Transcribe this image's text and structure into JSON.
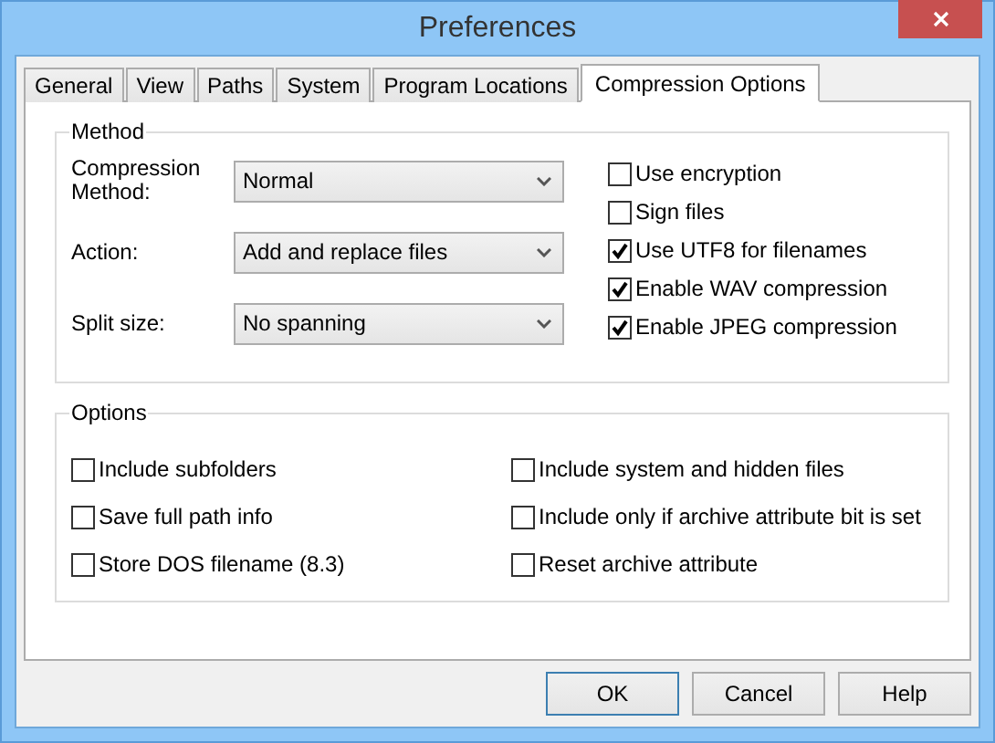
{
  "window": {
    "title": "Preferences"
  },
  "tabs": [
    {
      "label": "General",
      "selected": false
    },
    {
      "label": "View",
      "selected": false
    },
    {
      "label": "Paths",
      "selected": false
    },
    {
      "label": "System",
      "selected": false
    },
    {
      "label": "Program Locations",
      "selected": false
    },
    {
      "label": "Compression Options",
      "selected": true
    }
  ],
  "method": {
    "title": "Method",
    "fields": [
      {
        "label": "Compression Method:",
        "value": "Normal"
      },
      {
        "label": "Action:",
        "value": "Add and replace files"
      },
      {
        "label": "Split size:",
        "value": "No spanning"
      }
    ],
    "checkboxes": [
      {
        "label": "Use encryption",
        "checked": false
      },
      {
        "label": "Sign files",
        "checked": false
      },
      {
        "label": "Use UTF8 for filenames",
        "checked": true
      },
      {
        "label": "Enable WAV compression",
        "checked": true
      },
      {
        "label": "Enable JPEG compression",
        "checked": true
      }
    ]
  },
  "options": {
    "title": "Options",
    "checkboxes": [
      {
        "label": "Include subfolders",
        "checked": false
      },
      {
        "label": "Include system and hidden files",
        "checked": false
      },
      {
        "label": "Save full path info",
        "checked": false
      },
      {
        "label": "Include only if archive attribute bit is set",
        "checked": false
      },
      {
        "label": "Store DOS filename (8.3)",
        "checked": false
      },
      {
        "label": "Reset archive attribute",
        "checked": false
      }
    ]
  },
  "buttons": [
    {
      "label": "OK",
      "default": true
    },
    {
      "label": "Cancel",
      "default": false
    },
    {
      "label": "Help",
      "default": false
    }
  ]
}
